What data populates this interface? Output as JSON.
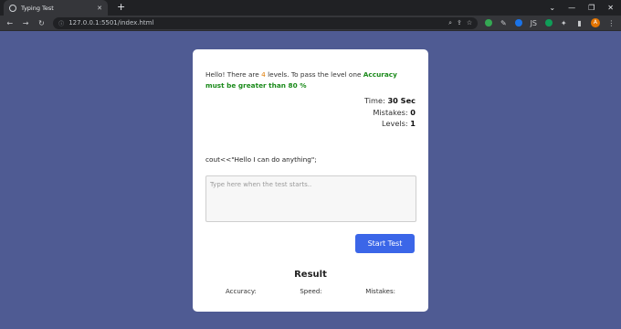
{
  "browser": {
    "tab_title": "Typing Test",
    "url": "127.0.0.1:5501/index.html"
  },
  "card": {
    "intro_pre": "Hello! There are ",
    "levels_count": "4",
    "intro_mid": " levels. To pass the level one ",
    "intro_accent": "Accuracy must be greater than 80 %",
    "stats": {
      "time_label": "Time:",
      "time_value": "30 Sec",
      "mistakes_label": "Mistakes:",
      "mistakes_value": "0",
      "levels_label": "Levels:",
      "levels_value": "1"
    },
    "code_prefix": "cout<<",
    "code_string": "\"Hello I can do anything\";",
    "input_placeholder": "Type here when the test starts..",
    "start_button": "Start Test",
    "result_title": "Result",
    "result_labels": {
      "accuracy": "Accuracy:",
      "speed": "Speed:",
      "mistakes": "Mistakes:"
    }
  }
}
